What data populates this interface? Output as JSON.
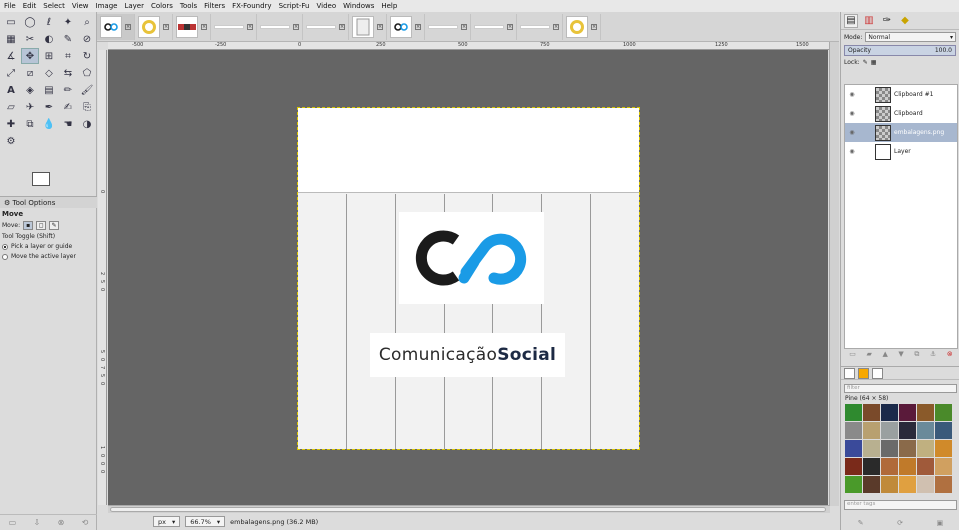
{
  "menu": [
    "File",
    "Edit",
    "Select",
    "View",
    "Image",
    "Layer",
    "Colors",
    "Tools",
    "Filters",
    "FX-Foundry",
    "Script-Fu",
    "Video",
    "Windows",
    "Help"
  ],
  "tool_options": {
    "tab_label": "Tool Options",
    "title": "Move",
    "move_label": "Move:",
    "toggle_label": "Tool Toggle  (Shift)",
    "option_pick": "Pick a layer or guide",
    "option_move_active": "Move the active layer"
  },
  "hruler": [
    "-500",
    "-250",
    "0",
    "250",
    "500",
    "750",
    "1000",
    "1250",
    "1500"
  ],
  "vruler": [
    "0",
    "2",
    "5",
    "0",
    "5",
    "0",
    "7",
    "5",
    "0",
    "1",
    "0",
    "0",
    "0"
  ],
  "canvas": {
    "brand_light": "Comunicação",
    "brand_bold": "Social",
    "logo_color_dark": "#1b1b1b",
    "logo_color_blue": "#1a9be6"
  },
  "status": {
    "unit": "px",
    "zoom": "66.7%",
    "file_info": "embalagens.png (36.2 MB)"
  },
  "layers_panel": {
    "mode_label": "Mode:",
    "mode_value": "Normal",
    "opacity_label": "Opacity",
    "opacity_value": "100.0",
    "lock_label": "Lock:",
    "layers": [
      {
        "name": "Clipboard #1",
        "selected": false
      },
      {
        "name": "Clipboard",
        "selected": false
      },
      {
        "name": "embalagens.png",
        "selected": true
      },
      {
        "name": "Layer",
        "selected": false
      }
    ]
  },
  "patterns_panel": {
    "filter_placeholder": "filter",
    "pattern_label": "Pine (64 × 58)",
    "tags_placeholder": "enter tags"
  },
  "colors": {
    "canvas_bg": "#656565",
    "selection": "#a7b7cf",
    "accent": "#f7a800"
  }
}
